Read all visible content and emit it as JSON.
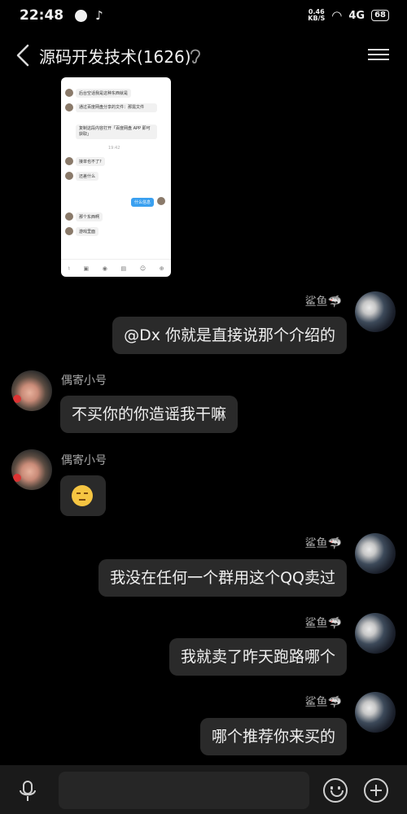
{
  "status_bar": {
    "time": "22:48",
    "speed_value": "0.46",
    "speed_unit": "KB/S",
    "signal": "4G",
    "battery": "68"
  },
  "header": {
    "title": "源码开发技术(1626)"
  },
  "screenshot_thumb": {
    "lines": [
      "后台空话我是这种东西就是",
      "通过百度网盘分享的文件：那需文件",
      "复制这段内容打开「百度网盘 APP 即可获取」",
      "接单也不了?",
      "还差什么",
      "什么信息",
      "那个东西啊",
      "游戏里面"
    ],
    "time": "19:42"
  },
  "messages": [
    {
      "side": "right",
      "sender": "鲨鱼🦈",
      "text": "@Dx 你就是直接说那个介绍的"
    },
    {
      "side": "left",
      "sender": "偶寄小号",
      "text": "不买你的你造谣我干嘛"
    },
    {
      "side": "left",
      "sender": "偶寄小号",
      "text": ""
    },
    {
      "side": "right",
      "sender": "鲨鱼🦈",
      "text": "我没在任何一个群用这个QQ卖过"
    },
    {
      "side": "right",
      "sender": "鲨鱼🦈",
      "text": "我就卖了昨天跑路哪个"
    },
    {
      "side": "right",
      "sender": "鲨鱼🦈",
      "text": "哪个推荐你来买的"
    }
  ],
  "input_bar": {
    "placeholder": ""
  },
  "colors": {
    "background": "#000000",
    "bubble": "#2a2a2a",
    "bottom_bar": "#1a1a1a"
  }
}
